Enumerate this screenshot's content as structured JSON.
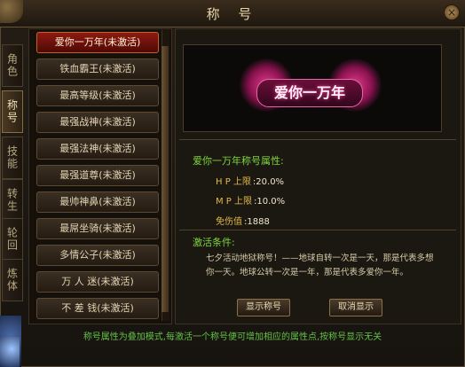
{
  "window": {
    "title": "称 号"
  },
  "tabs": [
    {
      "label": "角色"
    },
    {
      "label": "称号"
    },
    {
      "label": "技能"
    },
    {
      "label": "转生"
    },
    {
      "label": "轮回"
    },
    {
      "label": "炼体"
    }
  ],
  "titles": [
    {
      "label": "爱你一万年(未激活)"
    },
    {
      "label": "铁血霸王(未激活)"
    },
    {
      "label": "最高等级(未激活)"
    },
    {
      "label": "最强战神(未激活)"
    },
    {
      "label": "最强法神(未激活)"
    },
    {
      "label": "最强道尊(未激活)"
    },
    {
      "label": "最帅神鼻(未激活)"
    },
    {
      "label": "最屌坐骑(未激活)"
    },
    {
      "label": "多情公子(未激活)"
    },
    {
      "label": "万 人 迷(未激活)"
    },
    {
      "label": "不 差 钱(未激活)"
    }
  ],
  "banner": {
    "text": "爱你一万年"
  },
  "attributes": {
    "heading": "爱你一万年称号属性:",
    "rows": [
      {
        "key": "H P 上限",
        "value": ":20.0%"
      },
      {
        "key": "M P 上限",
        "value": ":10.0%"
      },
      {
        "key": "免伤值",
        "value": ":1888"
      }
    ]
  },
  "activation": {
    "heading": "激活条件:",
    "line1": "七夕活动地狱称号！——地球自转一次是一天，那是代表多想",
    "line2": "你一天。地球公转一次是一年，那是代表多爱你一年。"
  },
  "buttons": {
    "show": "显示称号",
    "cancel": "取消显示"
  },
  "footer": "称号属性为叠加模式,每激活一个称号便可增加相应的属性点,按称号显示无关"
}
